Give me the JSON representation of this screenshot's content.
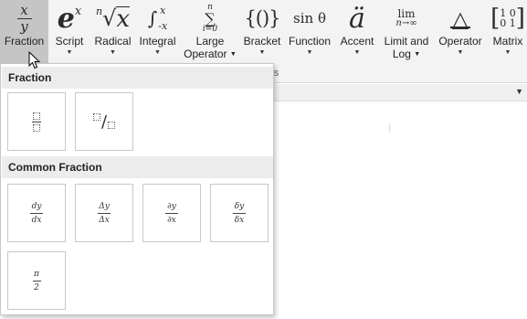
{
  "ribbon": {
    "buttons": [
      {
        "id": "fraction",
        "label": "Fraction",
        "icon": "fraction-icon"
      },
      {
        "id": "script",
        "label": "Script",
        "icon": "script-icon"
      },
      {
        "id": "radical",
        "label": "Radical",
        "icon": "radical-icon"
      },
      {
        "id": "integral",
        "label": "Integral",
        "icon": "integral-icon"
      },
      {
        "id": "large-operator",
        "label1": "Large",
        "label2": "Operator",
        "icon": "large-operator-icon"
      },
      {
        "id": "bracket",
        "label": "Bracket",
        "icon": "bracket-icon"
      },
      {
        "id": "function",
        "label": "Function",
        "icon": "function-icon"
      },
      {
        "id": "accent",
        "label": "Accent",
        "icon": "accent-icon"
      },
      {
        "id": "limit-and-log",
        "label1": "Limit and",
        "label2": "Log",
        "icon": "limit-icon"
      },
      {
        "id": "operator",
        "label": "Operator",
        "icon": "operator-icon"
      },
      {
        "id": "matrix",
        "label": "Matrix",
        "icon": "matrix-icon"
      }
    ],
    "icon_text": {
      "fraction_num": "x",
      "fraction_den": "y",
      "script_base": "e",
      "script_sup": "x",
      "radical_index": "n",
      "radical_body": "x",
      "integral_sym": "∫",
      "integral_upper": "x",
      "integral_lower": "-x",
      "sum_upper": "n",
      "sum_sym": "∑",
      "sum_lower": "i=0",
      "bracket": "{()}",
      "function": "sin θ",
      "accent": "ä",
      "limit_top": "lim",
      "limit_bottom": "n→∞",
      "operator": "△",
      "matrix_row1": "1 0",
      "matrix_row2": "0 1"
    },
    "group_label_fragment": "res"
  },
  "gallery": {
    "section1_title": "Fraction",
    "section2_title": "Common Fraction",
    "common_fractions": [
      {
        "num": "dy",
        "den": "dx"
      },
      {
        "num": "Δy",
        "den": "Δx"
      },
      {
        "num": "∂y",
        "den": "∂x"
      },
      {
        "num": "δy",
        "den": "δx"
      },
      {
        "num": "π",
        "den": "2"
      }
    ],
    "skewed_slash": "/"
  },
  "colors": {
    "ribbon_bg": "#f3f3f3",
    "active_bg": "#c5c5c5",
    "section_bg": "#ececec",
    "tile_border": "#c8c8c8"
  }
}
